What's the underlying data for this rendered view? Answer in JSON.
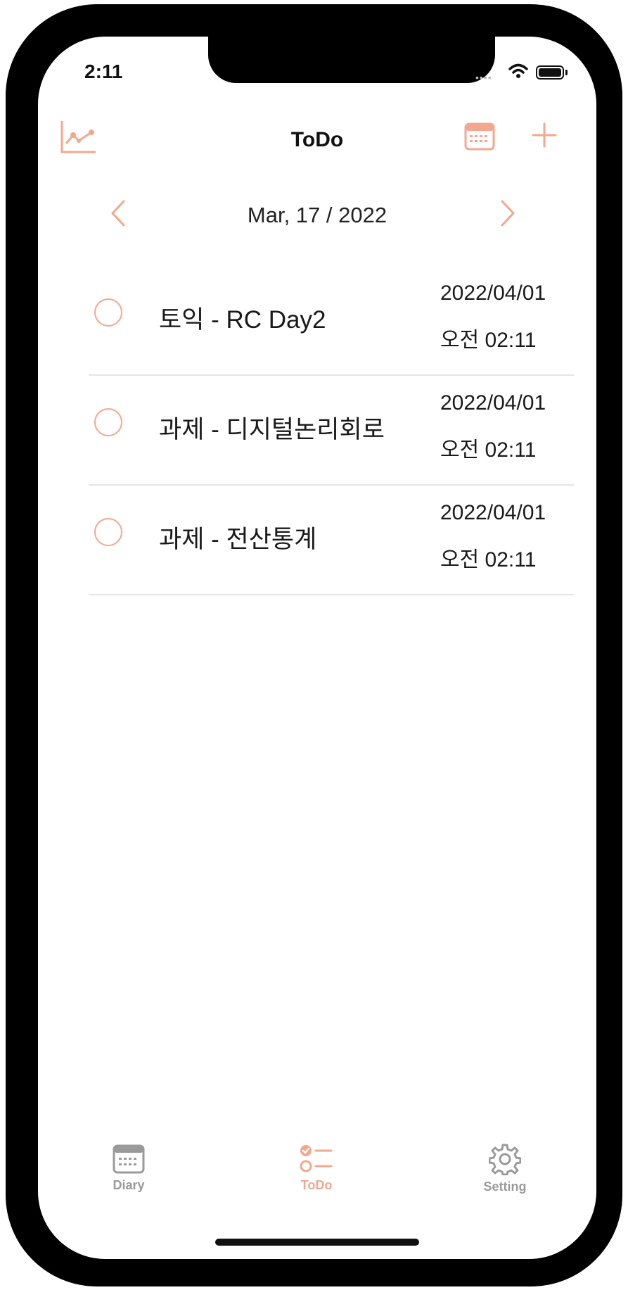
{
  "status_bar": {
    "time": "2:11",
    "signal": "••••"
  },
  "nav": {
    "title": "ToDo",
    "icons": [
      "stats-chart-icon",
      "calendar-icon",
      "plus-icon"
    ]
  },
  "date_nav": {
    "label": "Mar, 17 / 2022"
  },
  "todos": [
    {
      "title": "토익 - RC Day2",
      "date": "2022/04/01",
      "time": "오전 02:11",
      "done": false
    },
    {
      "title": "과제 - 디지털논리회로",
      "date": "2022/04/01",
      "time": "오전 02:11",
      "done": false
    },
    {
      "title": "과제 - 전산통계",
      "date": "2022/04/01",
      "time": "오전 02:11",
      "done": false
    }
  ],
  "tab_bar": {
    "tabs": [
      {
        "label": "Diary",
        "icon": "calendar-icon",
        "active": false
      },
      {
        "label": "ToDo",
        "icon": "checklist-icon",
        "active": true
      },
      {
        "label": "Setting",
        "icon": "gear-icon",
        "active": false
      }
    ]
  },
  "colors": {
    "accent": "#f4a78f",
    "inactive": "#9a9a9a",
    "text": "#1a1a1a",
    "divider": "#e6e6e6"
  }
}
